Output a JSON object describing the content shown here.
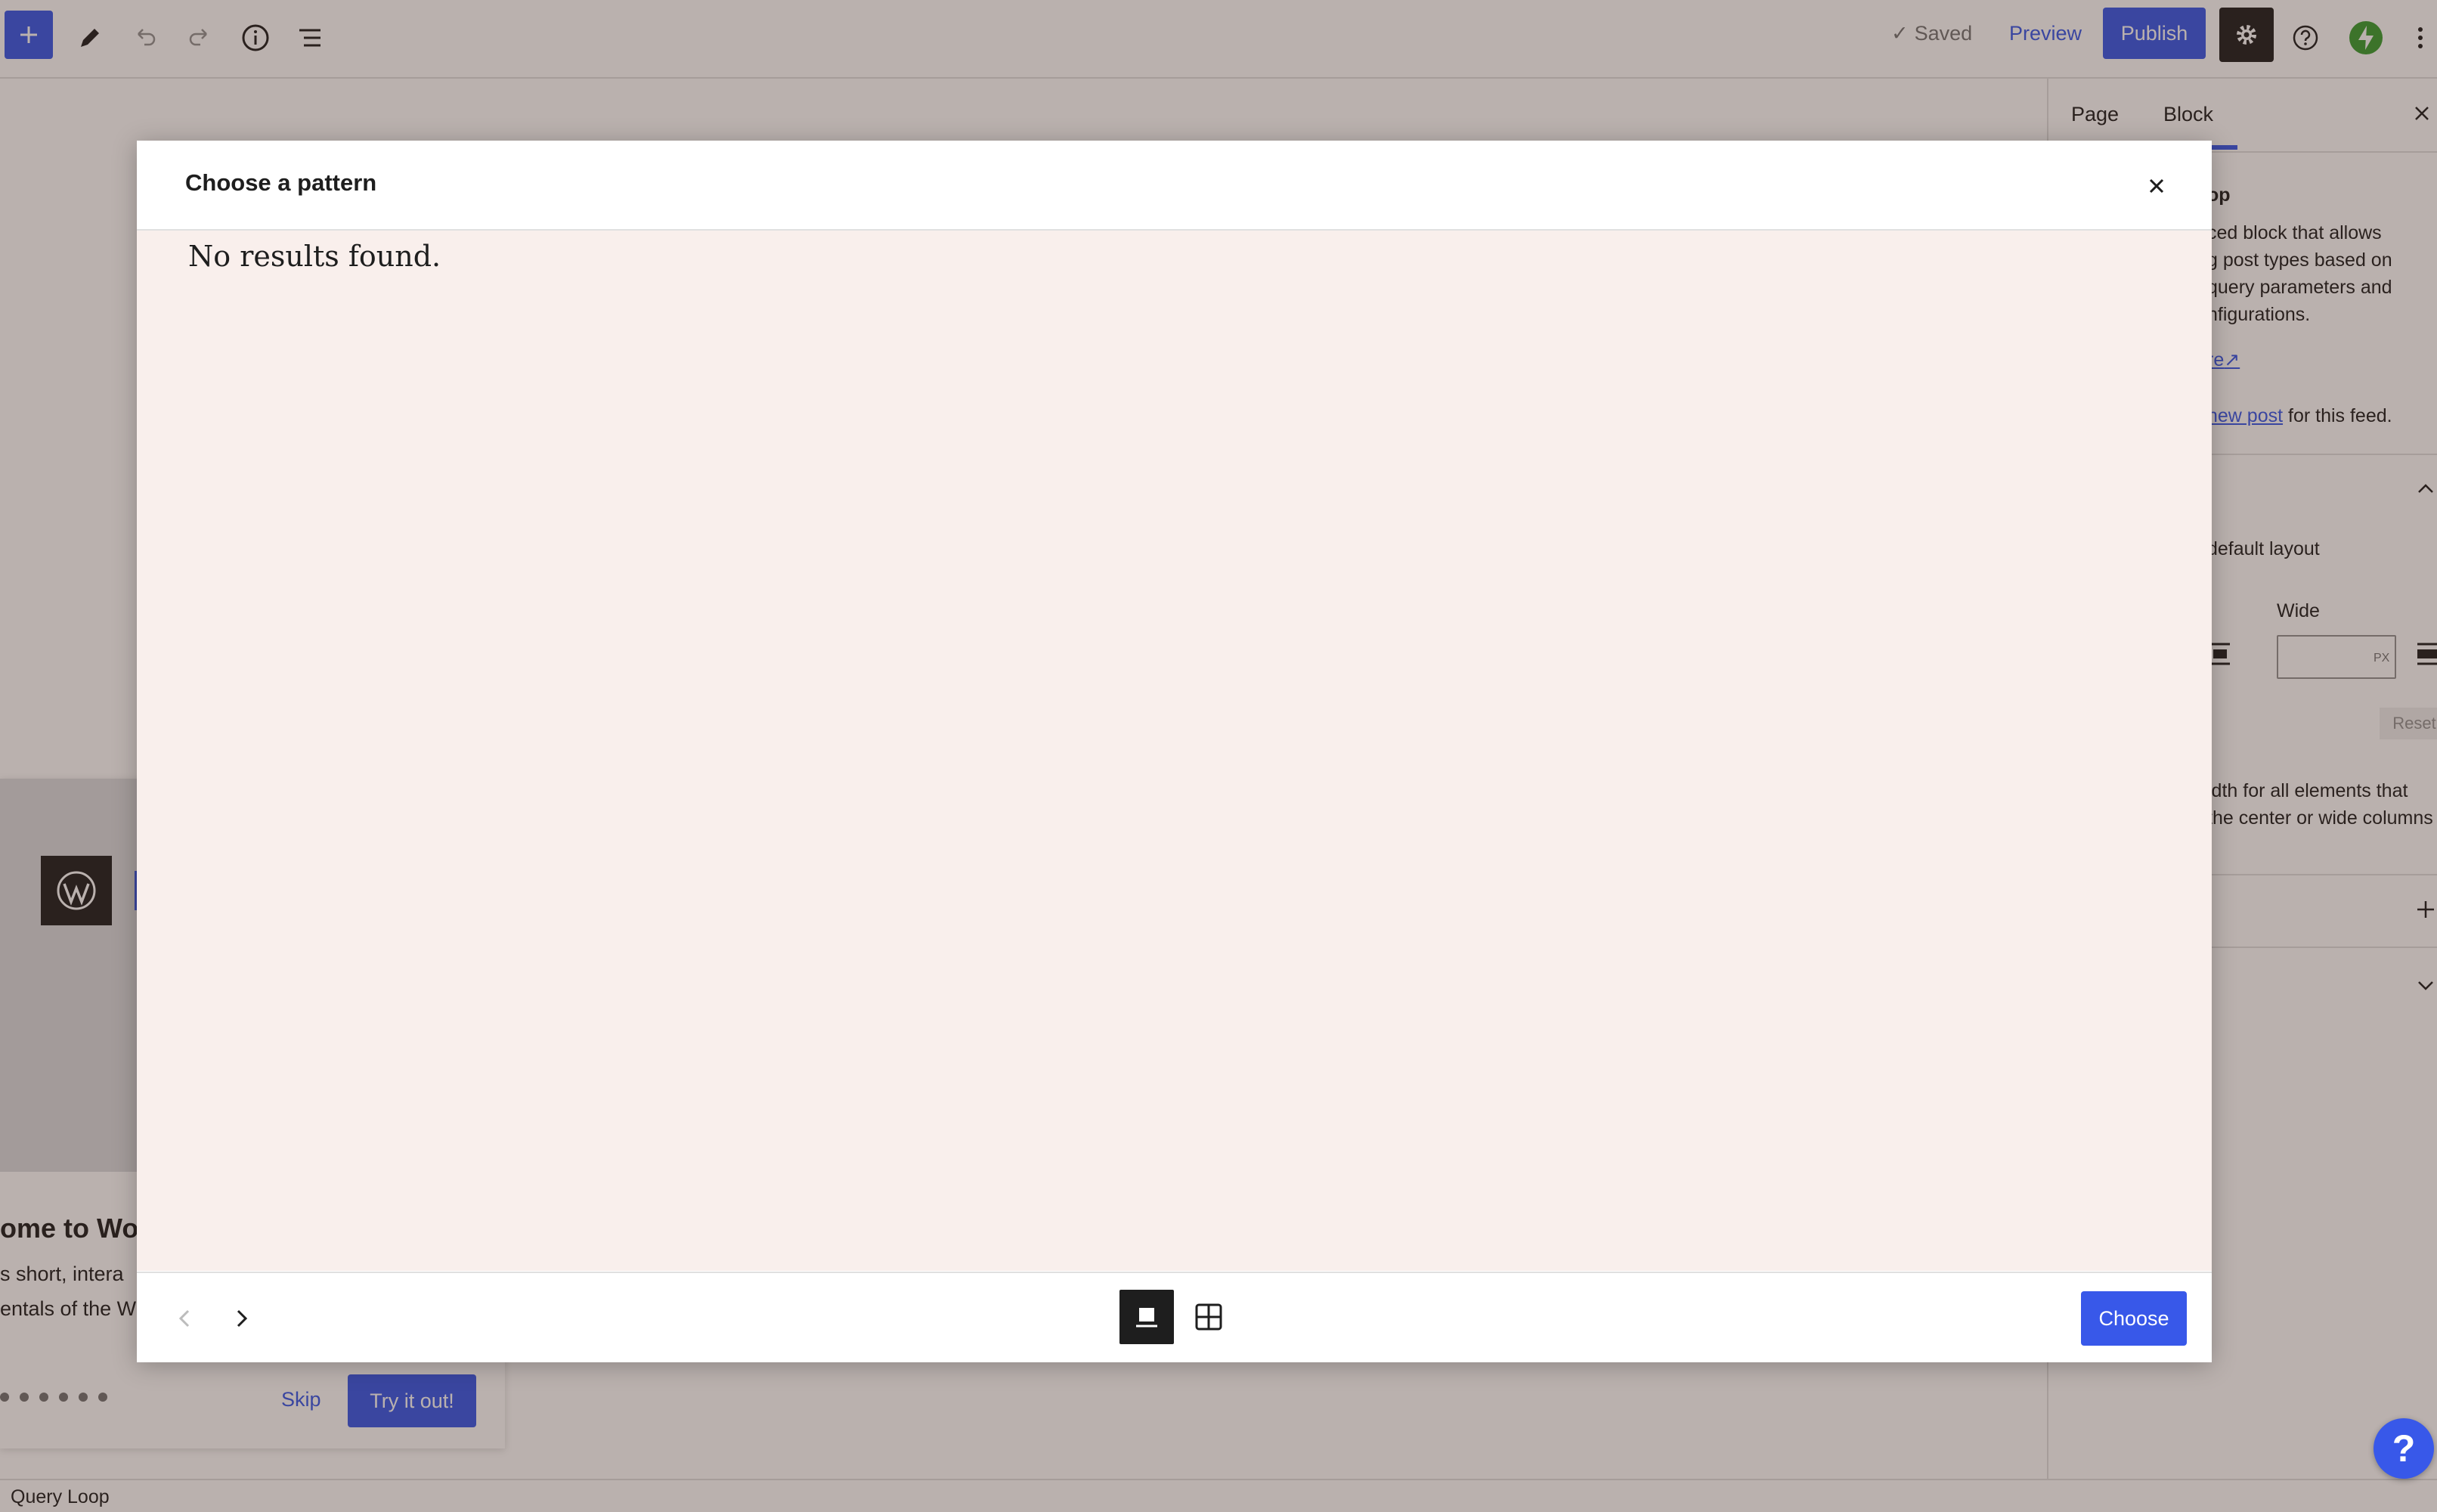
{
  "toolbar": {
    "saved_label": "Saved",
    "preview_label": "Preview",
    "publish_label": "Publish"
  },
  "canvas": {
    "guide": {
      "title": "ome to Wor",
      "lines": [
        "s short, intera",
        "entals of the W"
      ],
      "skip_label": "Skip",
      "try_label": "Try it out!",
      "dot_count": 6
    }
  },
  "sidebar": {
    "tabs": [
      {
        "label": "Page",
        "active": false
      },
      {
        "label": "Block",
        "active": true
      }
    ],
    "block_name": "op",
    "description": [
      "ced block that allows",
      "g post types based on",
      "query parameters and",
      "nfigurations."
    ],
    "learn_more": "re",
    "new_post_link": "new post",
    "new_post_suffix": "for this feed.",
    "layout_label": "default layout",
    "wide_label": "Wide",
    "wide_unit": "PX",
    "reset_label": "Reset",
    "layout_help": [
      "idth for all elements that",
      "the center or wide columns"
    ]
  },
  "statusbar": {
    "breadcrumb": "Query Loop"
  },
  "modal": {
    "title": "Choose a pattern",
    "empty_message": "No results found.",
    "choose_label": "Choose",
    "view_mode": "single"
  },
  "colors": {
    "accent": "#3858e9",
    "dark": "#1e1e1e",
    "modal_body_bg": "#f9efec",
    "avatar_green": "#3a9e31"
  },
  "help_bubble_label": "?"
}
